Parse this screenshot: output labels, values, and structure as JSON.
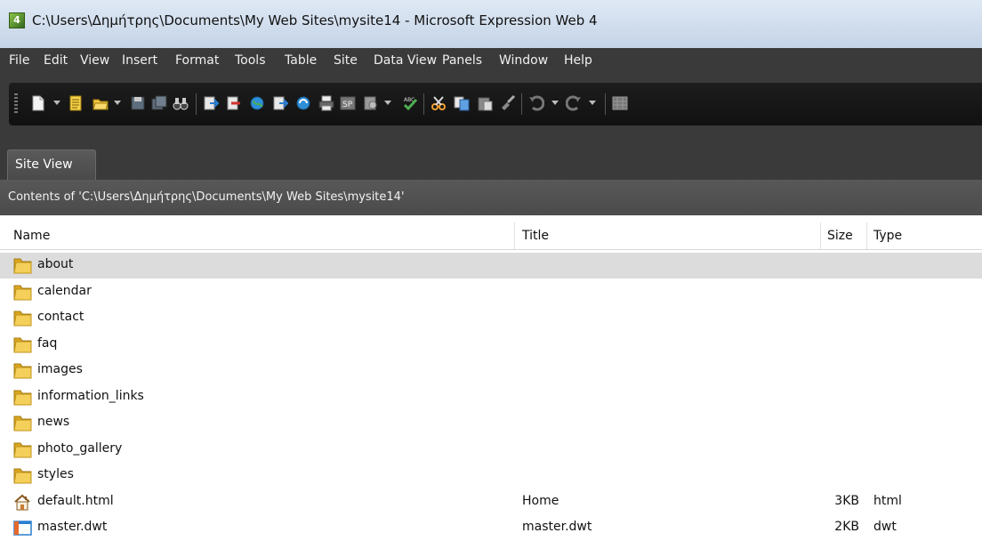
{
  "window": {
    "title": "C:\\Users\\Δημήτρης\\Documents\\My Web Sites\\mysite14 - Microsoft Expression Web 4",
    "app_icon_letter": "4"
  },
  "menu": [
    "File",
    "Edit",
    "View",
    "Insert",
    "Format",
    "Tools",
    "Table",
    "Site",
    "Data View",
    "Panels",
    "Window",
    "Help"
  ],
  "toolbar": {
    "buttons": [
      "new-page-icon",
      "new-document-icon",
      "open-folder-icon",
      "save-icon",
      "save-all-icon",
      "find-binoculars-icon",
      "preview-icon",
      "publish-icon",
      "web-globe-icon",
      "publish-alt-icon",
      "refresh-globe-icon",
      "print-icon",
      "sharepoint-icon",
      "preview-browser-icon",
      "spelling-check-icon",
      "cut-icon",
      "copy-icon",
      "paste-icon",
      "format-painter-icon",
      "undo-icon",
      "redo-icon",
      "table-icon"
    ]
  },
  "tab": {
    "label": "Site View"
  },
  "path": {
    "label": "Contents of 'C:\\Users\\Δημήτρης\\Documents\\My Web Sites\\mysite14'"
  },
  "columns": {
    "name": "Name",
    "title": "Title",
    "size": "Size",
    "type": "Type"
  },
  "files": [
    {
      "name": "about",
      "title": "",
      "size": "",
      "type": "",
      "icon": "folder-icon",
      "selected": true
    },
    {
      "name": "calendar",
      "title": "",
      "size": "",
      "type": "",
      "icon": "folder-icon"
    },
    {
      "name": "contact",
      "title": "",
      "size": "",
      "type": "",
      "icon": "folder-icon"
    },
    {
      "name": "faq",
      "title": "",
      "size": "",
      "type": "",
      "icon": "folder-icon"
    },
    {
      "name": "images",
      "title": "",
      "size": "",
      "type": "",
      "icon": "folder-icon"
    },
    {
      "name": "information_links",
      "title": "",
      "size": "",
      "type": "",
      "icon": "folder-icon"
    },
    {
      "name": "news",
      "title": "",
      "size": "",
      "type": "",
      "icon": "folder-icon"
    },
    {
      "name": "photo_gallery",
      "title": "",
      "size": "",
      "type": "",
      "icon": "folder-icon"
    },
    {
      "name": "styles",
      "title": "",
      "size": "",
      "type": "",
      "icon": "folder-icon"
    },
    {
      "name": "default.html",
      "title": "Home",
      "size": "3KB",
      "type": "html",
      "icon": "home-page-icon"
    },
    {
      "name": "master.dwt",
      "title": "master.dwt",
      "size": "2KB",
      "type": "dwt",
      "icon": "template-file-icon"
    }
  ],
  "colors": {
    "chrome_dark": "#3a3a3a",
    "selection": "#dcdcdc",
    "folder": "#e8b830"
  }
}
